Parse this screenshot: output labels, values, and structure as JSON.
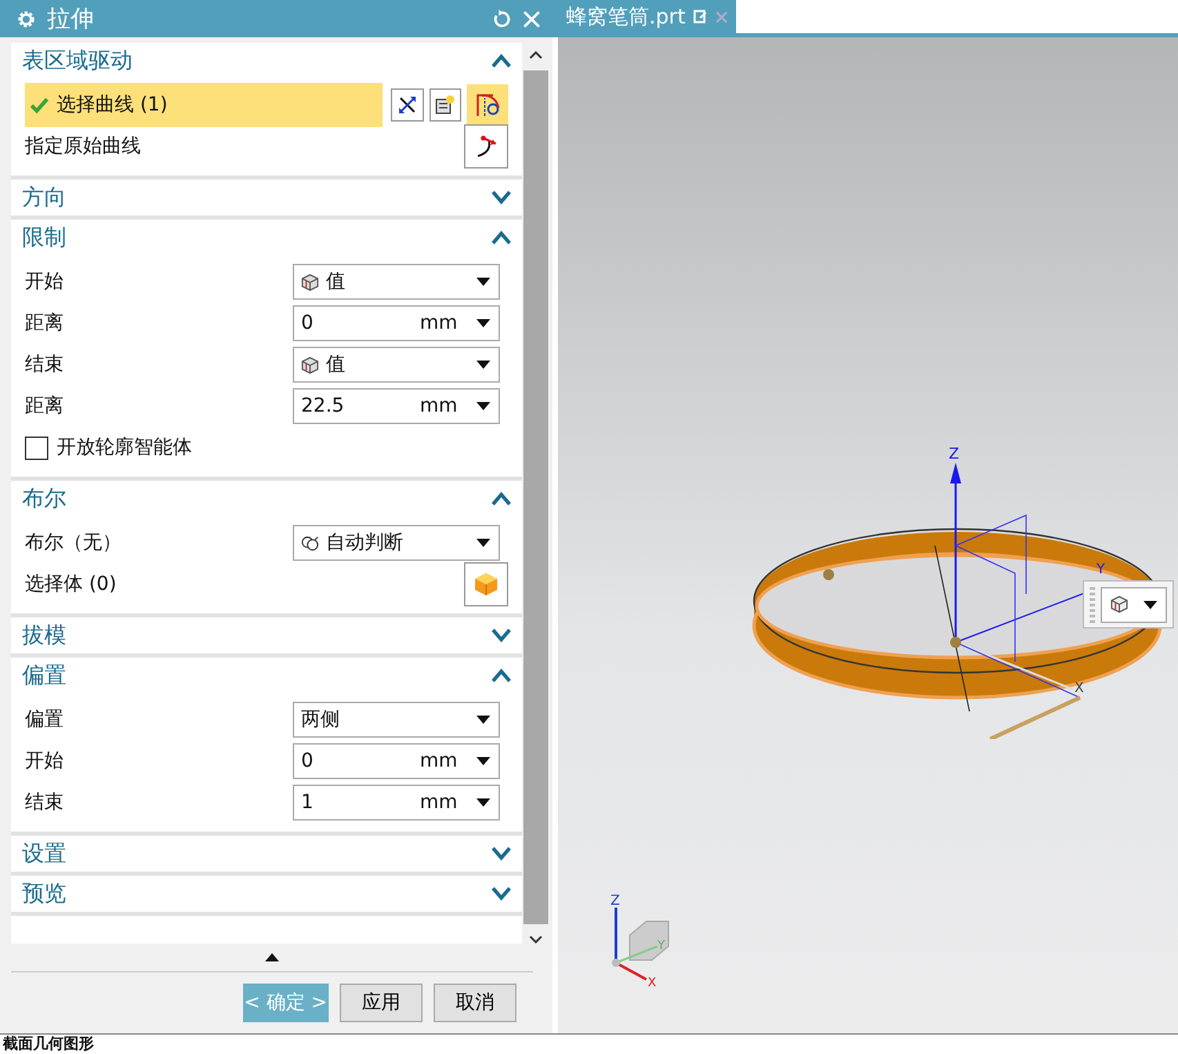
{
  "dialog": {
    "title": "拉伸"
  },
  "sections": [
    {
      "title": "表区域驱动",
      "expanded": true,
      "rows": [
        {
          "kind": "select",
          "label": "选择曲线 (1)",
          "selected": true,
          "done": true
        },
        {
          "kind": "curve-pick",
          "label": "指定原始曲线"
        }
      ]
    },
    {
      "title": "方向",
      "expanded": false
    },
    {
      "title": "限制",
      "expanded": true,
      "rows": [
        {
          "kind": "mode-dropdown",
          "label": "开始",
          "value": "值"
        },
        {
          "kind": "number",
          "label": "距离",
          "value": "0",
          "unit": "mm"
        },
        {
          "kind": "mode-dropdown",
          "label": "结束",
          "value": "值"
        },
        {
          "kind": "number",
          "label": "距离",
          "value": "22.5",
          "unit": "mm"
        },
        {
          "kind": "checkbox",
          "label": "开放轮廓智能体",
          "checked": false
        }
      ]
    },
    {
      "title": "布尔",
      "expanded": true,
      "rows": [
        {
          "kind": "bool-dropdown",
          "label": "布尔（无）",
          "value": "自动判断"
        },
        {
          "kind": "body-pick",
          "label": "选择体 (0)"
        }
      ]
    },
    {
      "title": "拔模",
      "expanded": false
    },
    {
      "title": "偏置",
      "expanded": true,
      "rows": [
        {
          "kind": "dropdown",
          "label": "偏置",
          "value": "两侧"
        },
        {
          "kind": "number",
          "label": "开始",
          "value": "0",
          "unit": "mm"
        },
        {
          "kind": "number",
          "label": "结束",
          "value": "1",
          "unit": "mm"
        }
      ]
    },
    {
      "title": "设置",
      "expanded": false
    },
    {
      "title": "预览",
      "expanded": false
    }
  ],
  "buttons": [
    {
      "label": "< 确定 >",
      "primary": true
    },
    {
      "label": "应用",
      "primary": false
    },
    {
      "label": "取消",
      "primary": false
    }
  ],
  "tab": {
    "title": "蜂窝笔筒.prt"
  },
  "viewport": {
    "model_axes": [
      "Z",
      "Y",
      "X"
    ],
    "view_triad": [
      "Z",
      "Y",
      "X"
    ]
  },
  "status_bar": {
    "text": "截面几何图形"
  }
}
